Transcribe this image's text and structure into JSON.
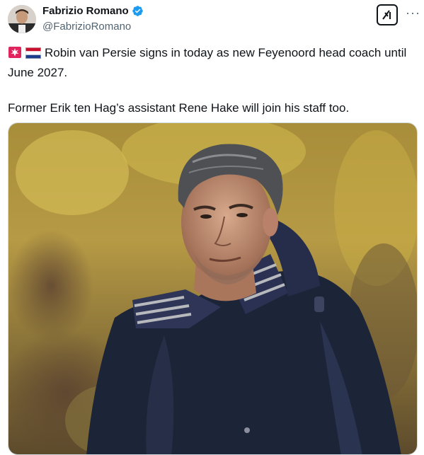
{
  "author": {
    "display_name": "Fabrizio Romano",
    "handle": "@FabrizioRomano",
    "verified": true,
    "avatar_icon": "avatar-photo"
  },
  "actions": {
    "grok_icon": "grok-icon",
    "more_icon": "more-horizontal-icon",
    "more_label": "···"
  },
  "tweet": {
    "emojis": [
      "siren-icon",
      "netherlands-flag-icon"
    ],
    "line1": "Robin van Persie signs in today as new Feyenoord head coach until June 2027.",
    "line2": "Former Erik ten Hag’s assistant Rene Hake will join his staff too."
  },
  "media": {
    "type": "photo",
    "icon": "portrait-photo"
  },
  "colors": {
    "text": "#0f1419",
    "secondary": "#536471",
    "verified": "#1d9bf0",
    "border": "#cfd9de"
  }
}
